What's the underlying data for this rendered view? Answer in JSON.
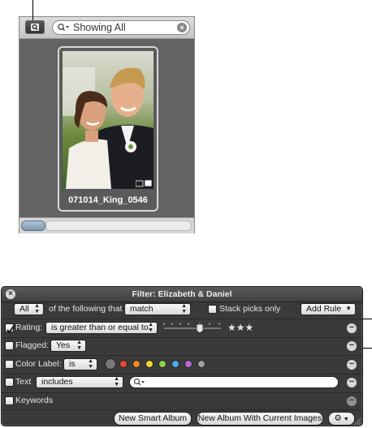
{
  "browser": {
    "search_text": "Showing All",
    "photo_name": "071014_King_0546"
  },
  "filter_hud": {
    "title": "Filter: Elizabeth & Daniel",
    "match_scope": "All",
    "following_text": "of the following that",
    "match_mode": "match",
    "stack_picks_label": "Stack picks only",
    "add_rule_label": "Add Rule",
    "rules": {
      "rating": {
        "label": "Rating:",
        "operator": "is greater than or equal to",
        "stars": "★★★",
        "checked": true
      },
      "flagged": {
        "label": "Flagged:",
        "value": "Yes",
        "checked": false
      },
      "color_label": {
        "label": "Color Label:",
        "operator": "is",
        "checked": false,
        "colors": [
          "#777777",
          "#e6473c",
          "#f08a2a",
          "#f2d23a",
          "#8ed24a",
          "#4aa9e6",
          "#b06ad6",
          "#a0a0a0"
        ]
      },
      "text": {
        "label": "Text",
        "operator": "includes",
        "checked": false
      },
      "keywords": {
        "label": "Keywords",
        "checked": false
      }
    },
    "new_smart_album_label": "New Smart Album",
    "new_album_with_current_label": "New Album With Current Images"
  }
}
